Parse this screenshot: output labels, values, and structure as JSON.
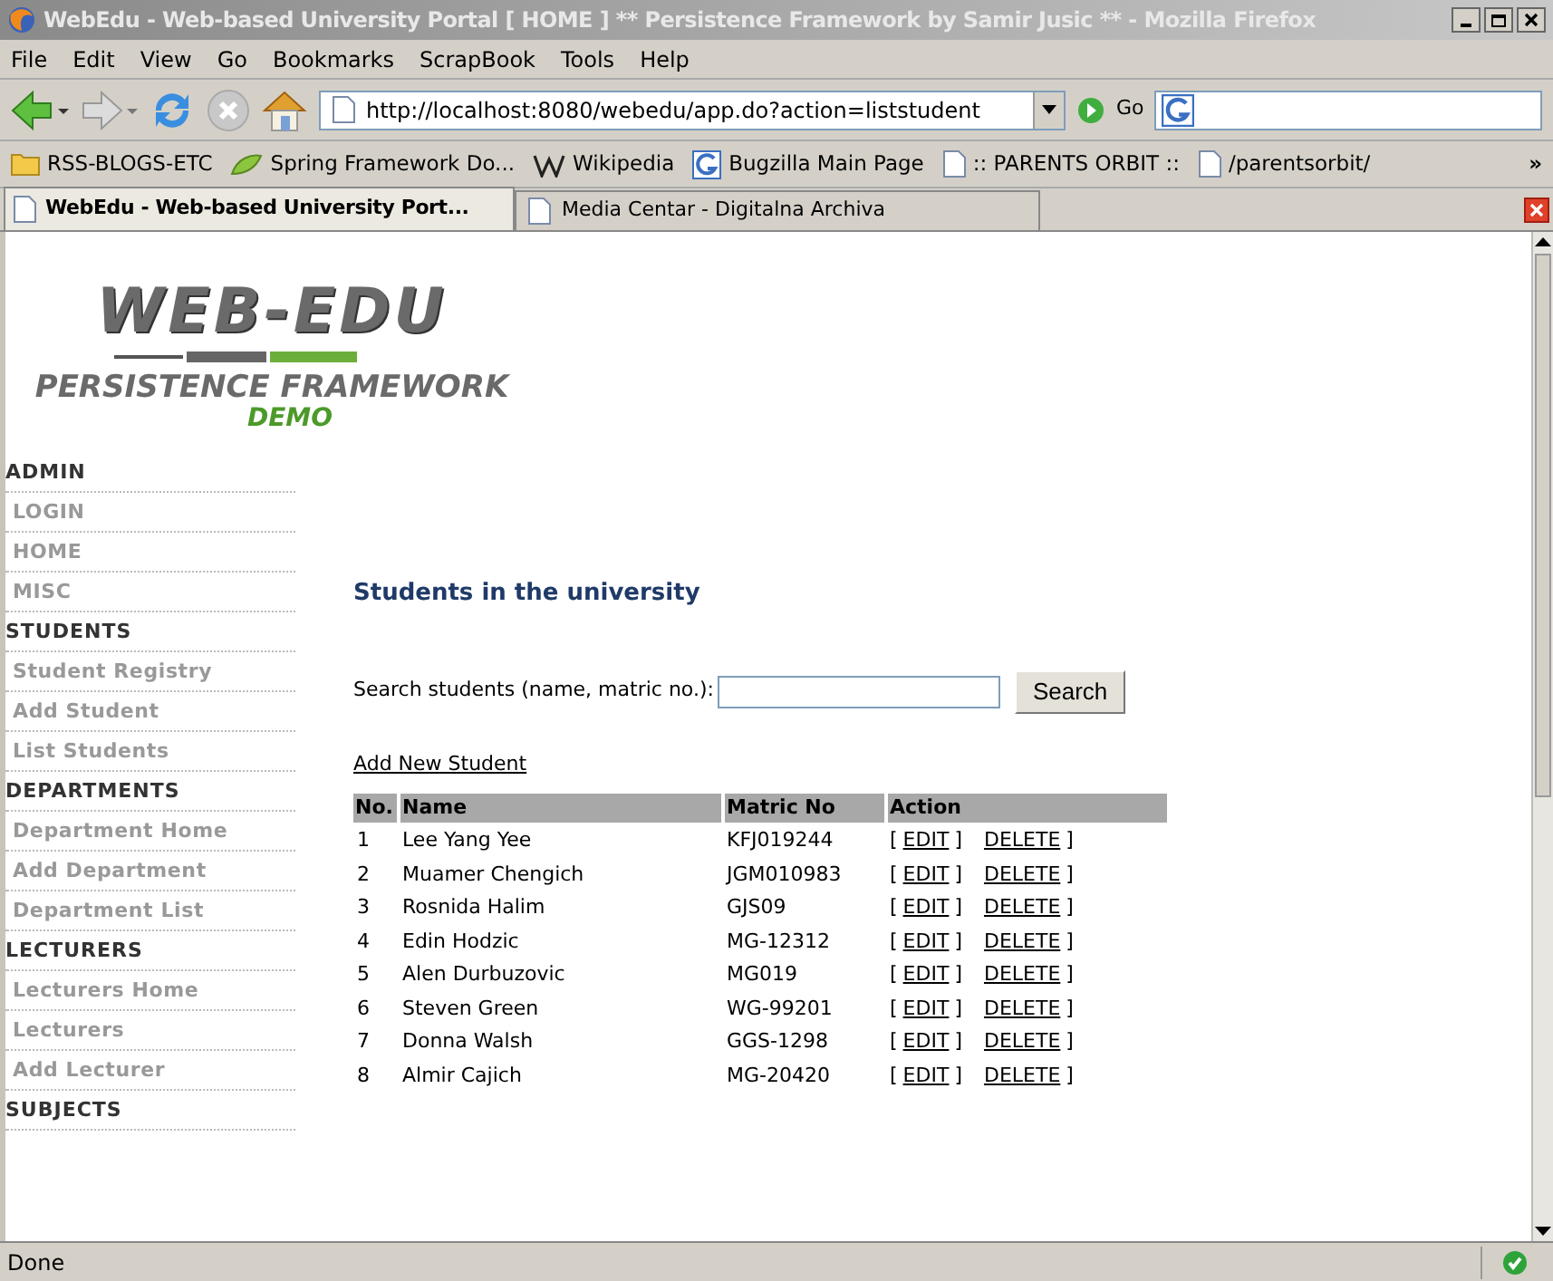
{
  "window": {
    "title": "WebEdu - Web-based University Portal [ HOME ] ** Persistence Framework by Samir Jusic ** - Mozilla Firefox"
  },
  "menu": [
    "File",
    "Edit",
    "View",
    "Go",
    "Bookmarks",
    "ScrapBook",
    "Tools",
    "Help"
  ],
  "toolbar": {
    "url": "http://localhost:8080/webedu/app.do?action=liststudent",
    "go": "Go"
  },
  "bookmarks": [
    {
      "label": "RSS-BLOGS-ETC",
      "kind": "folder"
    },
    {
      "label": "Spring Framework Do...",
      "kind": "leaf"
    },
    {
      "label": "Wikipedia",
      "kind": "wiki"
    },
    {
      "label": "Bugzilla Main Page",
      "kind": "google"
    },
    {
      "label": ":: PARENTS ORBIT ::",
      "kind": "page"
    },
    {
      "label": "/parentsorbit/",
      "kind": "page"
    }
  ],
  "bookmarks_more": "»",
  "tabs": [
    {
      "label": "WebEdu - Web-based University Port...",
      "selected": true
    },
    {
      "label": "Media Centar - Digitalna Archiva",
      "selected": false
    }
  ],
  "logo": {
    "title": "WEB-EDU",
    "subtitle": "PERSISTENCE FRAMEWORK",
    "tag": "DEMO"
  },
  "sidebar": [
    {
      "label": "ADMIN",
      "kind": "header"
    },
    {
      "label": "LOGIN",
      "kind": "item"
    },
    {
      "label": "HOME",
      "kind": "item"
    },
    {
      "label": "MISC",
      "kind": "item"
    },
    {
      "label": "STUDENTS",
      "kind": "header"
    },
    {
      "label": "Student Registry",
      "kind": "item"
    },
    {
      "label": "Add Student",
      "kind": "item"
    },
    {
      "label": "List Students",
      "kind": "item"
    },
    {
      "label": "DEPARTMENTS",
      "kind": "header"
    },
    {
      "label": "Department Home",
      "kind": "item"
    },
    {
      "label": "Add Department",
      "kind": "item"
    },
    {
      "label": "Department List",
      "kind": "item"
    },
    {
      "label": "LECTURERS",
      "kind": "header"
    },
    {
      "label": "Lecturers Home",
      "kind": "item"
    },
    {
      "label": "Lecturers",
      "kind": "item"
    },
    {
      "label": "Add Lecturer",
      "kind": "item"
    },
    {
      "label": "SUBJECTS",
      "kind": "header"
    }
  ],
  "heading": "Students in the university",
  "search": {
    "label": "Search students (name, matric no.):",
    "button": "Search"
  },
  "add_link": "Add New Student",
  "table": {
    "columns": [
      "No.",
      "Name",
      "Matric No",
      "Action"
    ],
    "rows": [
      {
        "no": "1",
        "name": "Lee Yang Yee",
        "matric": "KFJ019244",
        "actions": [
          {
            "prefix": "[",
            "link": "EDIT",
            "suffix": "]"
          },
          {
            "link": "DELETE",
            "suffix": "]"
          }
        ]
      },
      {
        "no": "2",
        "name": "Muamer Chengich",
        "matric": "JGM010983",
        "actions": [
          {
            "prefix": "[",
            "link": "EDIT",
            "suffix": "]"
          },
          {
            "link": "DELETE",
            "suffix": "]"
          }
        ]
      },
      {
        "no": "3",
        "name": "Rosnida Halim",
        "matric": "GJS09",
        "actions": [
          {
            "prefix": "[",
            "link": "EDIT",
            "suffix": "]"
          },
          {
            "link": "DELETE",
            "suffix": "]"
          }
        ]
      },
      {
        "no": "4",
        "name": "Edin Hodzic",
        "matric": "MG-12312",
        "actions": [
          {
            "prefix": "[",
            "link": "EDIT",
            "suffix": "]"
          },
          {
            "link": "DELETE",
            "suffix": "]"
          }
        ]
      },
      {
        "no": "5",
        "name": "Alen Durbuzovic",
        "matric": "MG019",
        "actions": [
          {
            "prefix": "[",
            "link": "EDIT",
            "suffix": "]"
          },
          {
            "link": "DELETE",
            "suffix": "]"
          }
        ]
      },
      {
        "no": "6",
        "name": "Steven Green",
        "matric": "WG-99201",
        "actions": [
          {
            "prefix": "[",
            "link": "EDIT",
            "suffix": "]"
          },
          {
            "link": "DELETE",
            "suffix": "]"
          }
        ]
      },
      {
        "no": "7",
        "name": "Donna Walsh",
        "matric": "GGS-1298",
        "actions": [
          {
            "prefix": "[",
            "link": "EDIT",
            "suffix": "]"
          },
          {
            "link": "DELETE",
            "suffix": "]"
          }
        ]
      },
      {
        "no": "8",
        "name": "Almir Cajich",
        "matric": "MG-20420",
        "actions": [
          {
            "prefix": "[",
            "link": "EDIT",
            "suffix": "]"
          },
          {
            "link": "DELETE",
            "suffix": "]"
          }
        ]
      }
    ]
  },
  "status_bar": {
    "text": "Done"
  }
}
